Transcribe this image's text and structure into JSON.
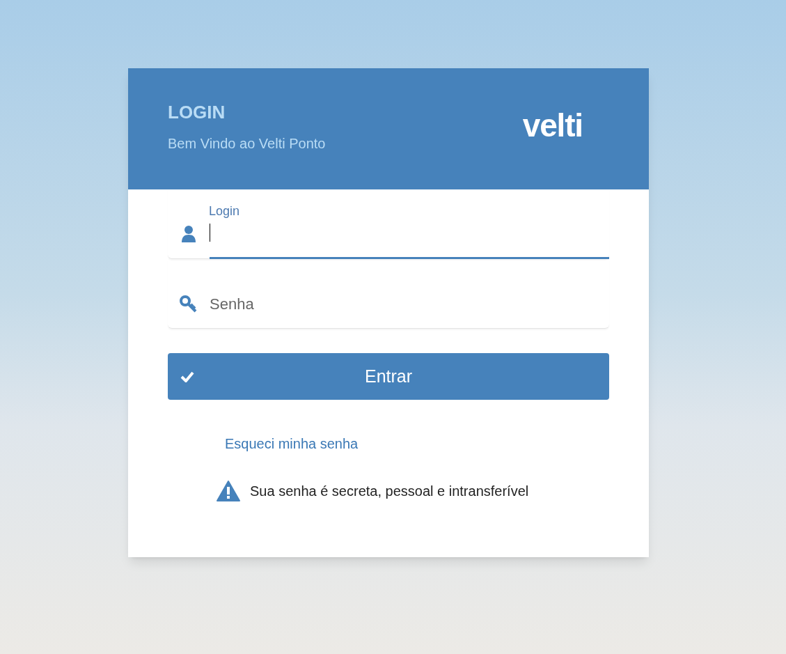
{
  "header": {
    "title": "LOGIN",
    "subtitle": "Bem Vindo ao Velti Ponto",
    "logo": "velti"
  },
  "fields": [
    {
      "kind": "user",
      "label": "Login",
      "focused": true
    },
    {
      "kind": "password",
      "placeholder": "Senha",
      "focused": false
    }
  ],
  "submit_button": "Entrar",
  "forgot_link": "Esqueci minha senha",
  "notice": "Sua senha é secreta, pessoal e intransferível"
}
